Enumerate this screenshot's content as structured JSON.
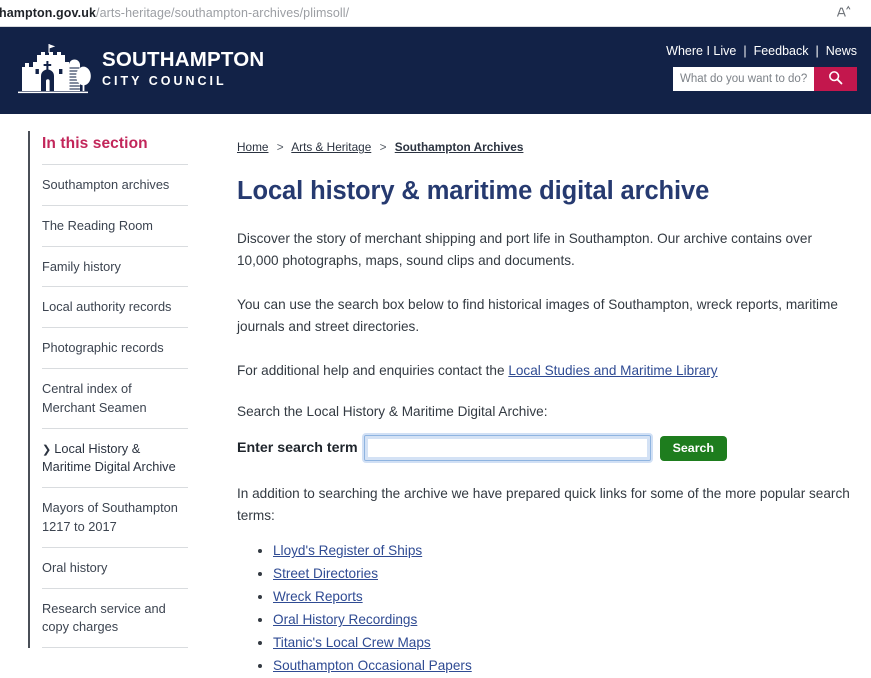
{
  "browser": {
    "url_host": "hampton.gov.uk",
    "url_path": "/arts-heritage/southampton-archives/plimsoll/",
    "read_aloud_icon": "read-aloud-icon"
  },
  "header": {
    "logo_title": "SOUTHAMPTON",
    "logo_subtitle": "CITY COUNCIL",
    "logo_icon": "bargate-castle-logo",
    "nav": [
      {
        "label": "Where I Live"
      },
      {
        "label": "Feedback"
      },
      {
        "label": "News"
      }
    ],
    "nav_separator": "|",
    "search": {
      "placeholder": "What do you want to do?",
      "value": "",
      "button_icon": "search-icon"
    },
    "bg_color": "#122247",
    "search_button_color": "#c3174d"
  },
  "sidebar": {
    "heading": "In this section",
    "heading_color": "#c2265a",
    "items": [
      {
        "label": "Southampton archives",
        "active": false
      },
      {
        "label": "The Reading Room",
        "active": false
      },
      {
        "label": "Family history",
        "active": false
      },
      {
        "label": "Local authority records",
        "active": false
      },
      {
        "label": "Photographic records",
        "active": false
      },
      {
        "label": "Central index of Merchant Seamen",
        "active": false
      },
      {
        "label": "Local History & Maritime Digital Archive",
        "active": true,
        "marker": "❯"
      },
      {
        "label": "Mayors of Southampton 1217 to 2017",
        "active": false
      },
      {
        "label": "Oral history",
        "active": false
      },
      {
        "label": "Research service and copy charges",
        "active": false
      }
    ]
  },
  "main": {
    "breadcrumb": {
      "items": [
        {
          "label": "Home",
          "current": false
        },
        {
          "label": "Arts & Heritage",
          "current": false
        },
        {
          "label": "Southampton Archives",
          "current": true
        }
      ],
      "separator": ">"
    },
    "title": "Local history & maritime digital archive",
    "title_color": "#263a70",
    "paragraph_1": "Discover the story of merchant shipping and port life in Southampton. Our archive contains over 10,000 photographs, maps, sound clips and documents.",
    "paragraph_2": "You can use the search box below to find historical images of Southampton, wreck reports, maritime journals and street directories.",
    "paragraph_3_prefix": "For additional help and enquiries contact the ",
    "paragraph_3_link": "Local Studies and Maritime Library",
    "search_intro": "Search the Local History & Maritime Digital Archive:",
    "search_form": {
      "field_label": "Enter search term",
      "input_value": "",
      "input_placeholder": "",
      "submit_label": "Search",
      "submit_color": "#1e7d1e",
      "focused": true
    },
    "quick_links_intro": "In addition to searching the archive we have prepared quick links for some of the more popular search terms:",
    "quick_links": [
      {
        "label": "Lloyd's Register of Ships"
      },
      {
        "label": "Street Directories"
      },
      {
        "label": "Wreck Reports"
      },
      {
        "label": "Oral History Recordings"
      },
      {
        "label": "Titanic's Local Crew Maps"
      },
      {
        "label": "Southampton Occasional Papers"
      }
    ],
    "link_color": "#2f4b93"
  }
}
